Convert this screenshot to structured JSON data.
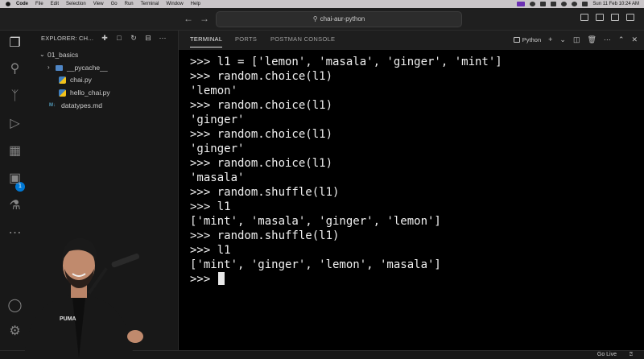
{
  "menubar": {
    "items": [
      "Code",
      "File",
      "Edit",
      "Selection",
      "View",
      "Go",
      "Run",
      "Terminal",
      "Window",
      "Help"
    ],
    "clock": "Sun 11 Feb 10:24 AM"
  },
  "titlebar": {
    "search_text": "chai-aur-python"
  },
  "activity": {
    "extensions_badge": "1"
  },
  "explorer": {
    "header": "EXPLORER: CH...",
    "items": [
      {
        "label": "01_basics",
        "kind": "folder-open"
      },
      {
        "label": "__pycache__",
        "kind": "folder"
      },
      {
        "label": "chai.py",
        "kind": "python"
      },
      {
        "label": "hello_chai.py",
        "kind": "python"
      },
      {
        "label": "datatypes.md",
        "kind": "markdown"
      }
    ]
  },
  "panel": {
    "tabs": [
      "TERMINAL",
      "PORTS",
      "POSTMAN CONSOLE"
    ],
    "active_tab": "TERMINAL",
    "profile": "Python"
  },
  "terminal": {
    "lines": [
      ">>> l1 = ['lemon', 'masala', 'ginger', 'mint']",
      ">>> random.choice(l1)",
      "'lemon'",
      ">>> random.choice(l1)",
      "'ginger'",
      ">>> random.choice(l1)",
      "'ginger'",
      ">>> random.choice(l1)",
      "'masala'",
      ">>> random.shuffle(l1)",
      ">>> l1",
      "['mint', 'masala', 'ginger', 'lemon']",
      ">>> random.shuffle(l1)",
      ">>> l1",
      "['mint', 'ginger', 'lemon', 'masala']"
    ],
    "prompt": ">>> "
  },
  "statusbar": {
    "golive": "Go Live"
  },
  "presenter": {
    "shirt_brand": "PUMA"
  }
}
